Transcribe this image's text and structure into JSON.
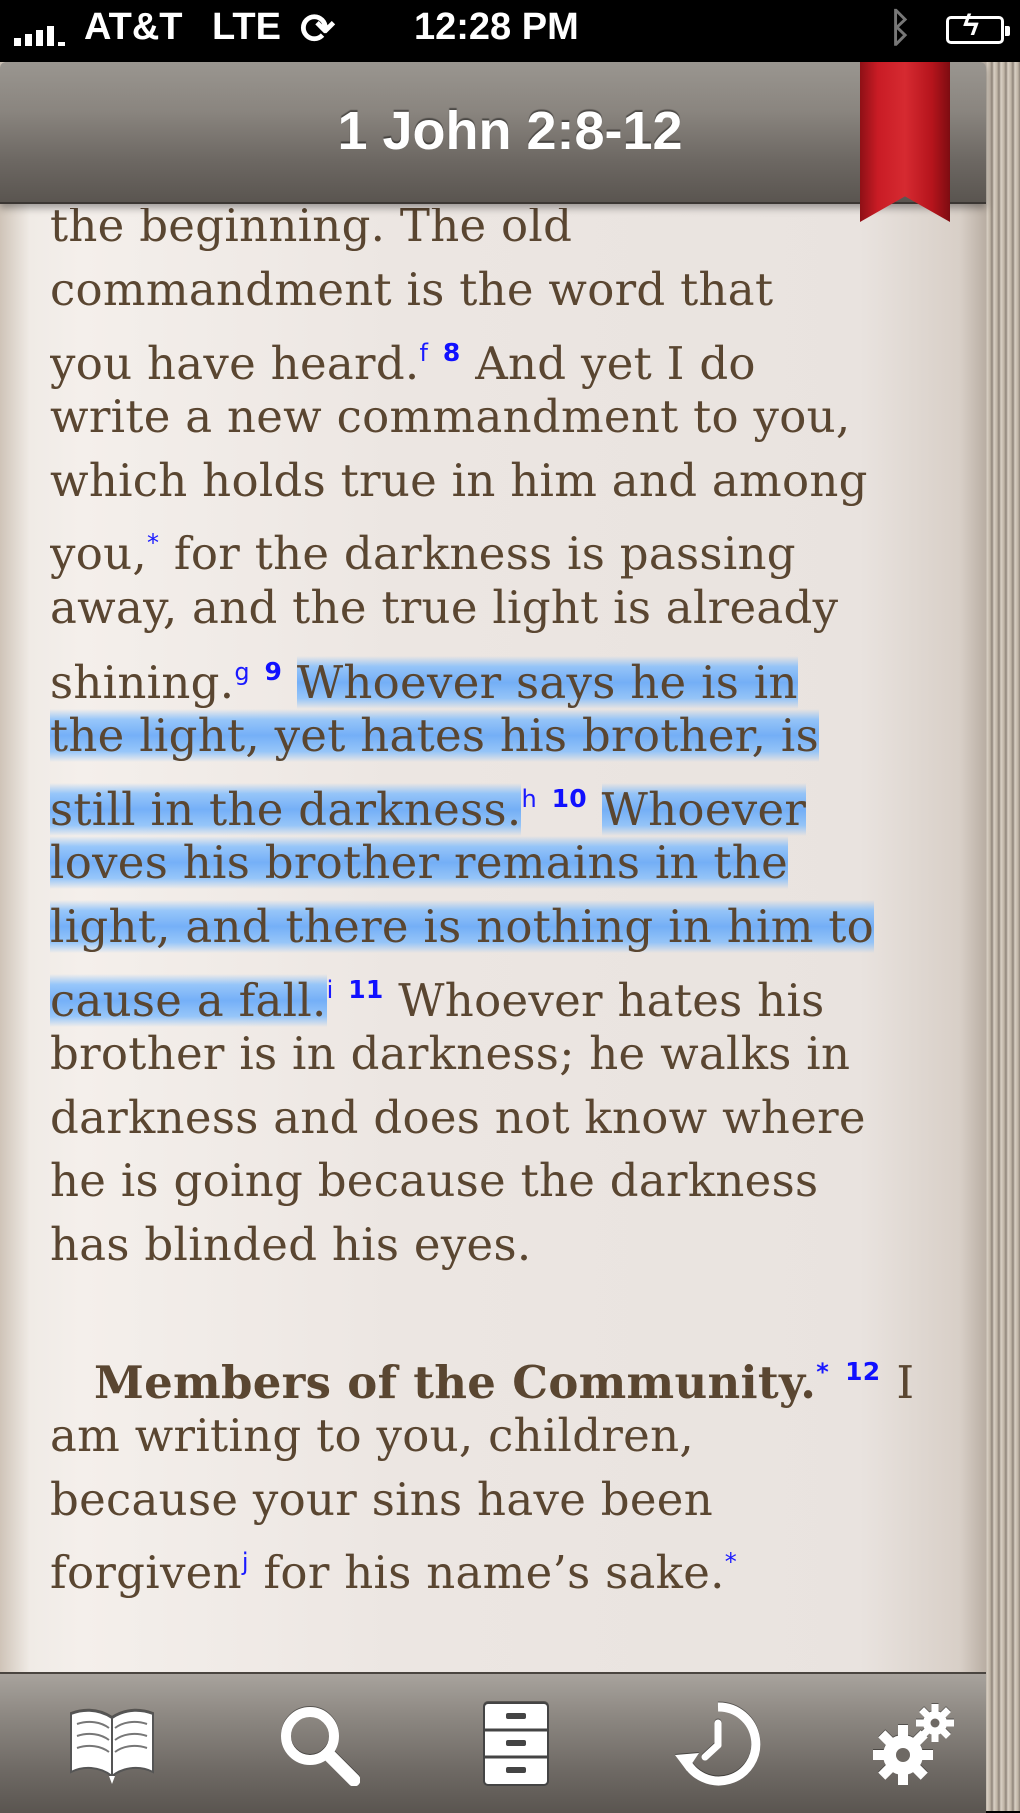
{
  "status_bar": {
    "carrier": "AT&T",
    "network": "LTE",
    "time": "12:28 PM",
    "sync_icon": "sync-icon",
    "bluetooth_icon": "bluetooth-icon",
    "battery_icon": "battery-charging-icon"
  },
  "header": {
    "title": "1 John 2:8-12",
    "bookmark_icon": "bookmark-ribbon-icon"
  },
  "text": {
    "l1": "the beginning. The old",
    "l2": "commandment is the word that",
    "l3a": "you have heard.",
    "fn_f": "f",
    "v8": "8",
    "l3b": "And yet I do",
    "l4": "write a new commandment to you,",
    "l5": "which holds true in him and among",
    "l6a": "you,",
    "fn_star1": "*",
    "l6b": " for the darkness is passing",
    "l7": "away, and the true light is already",
    "l8a": "shining.",
    "fn_g": "g",
    "v9": "9",
    "l8b": "Whoever says he is in",
    "l9": "the light, yet hates his brother, is",
    "l10a": "still in the darkness.",
    "fn_h": "h",
    "v10": "10",
    "l10b": "Whoever",
    "l11": "loves his brother remains in the",
    "l12": "light, and there is nothing in him to",
    "l13a": "cause a fall.",
    "fn_i": "i",
    "v11": "11",
    "l13b": "Whoever hates his",
    "l14": "brother is in darkness; he walks in",
    "l15": "darkness and does not know where",
    "l16": "he is going because the darkness",
    "l17": "has blinded his eyes.",
    "heading": "Members of the Community.",
    "fn_star2": "*",
    "v12": "12",
    "l19b": "I",
    "l20": "am writing to you, children,",
    "l21": "because your sins have been",
    "l22a": "forgiven",
    "fn_j": "j",
    "l22b": " for his name’s sake.",
    "fn_star3": "*"
  },
  "toolbar": {
    "items": [
      {
        "icon": "open-book-icon"
      },
      {
        "icon": "search-icon"
      },
      {
        "icon": "file-cabinet-icon"
      },
      {
        "icon": "history-clock-icon"
      },
      {
        "icon": "gears-icon"
      }
    ]
  },
  "colors": {
    "text": "#5a4631",
    "highlight": "#6aaef8",
    "footnote": "#1a1aff",
    "ribbon": "#c91c25"
  }
}
